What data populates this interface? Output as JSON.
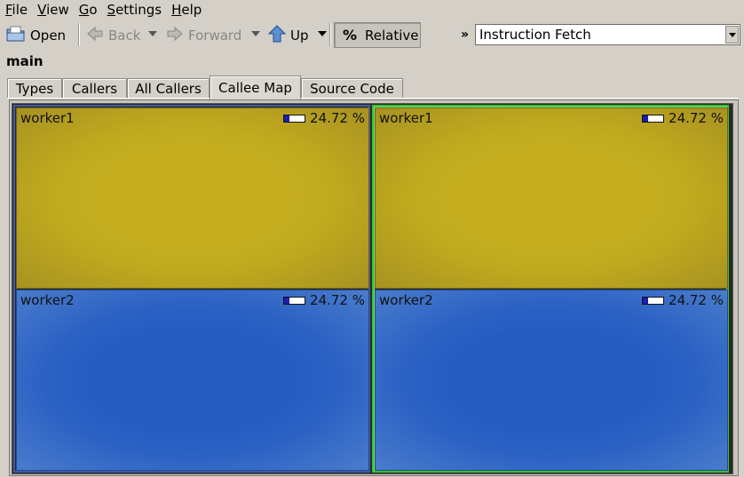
{
  "menubar": {
    "items": [
      {
        "label": "File",
        "u": "F",
        "rest": "ile"
      },
      {
        "label": "View",
        "u": "V",
        "rest": "iew"
      },
      {
        "label": "Go",
        "u": "G",
        "rest": "o"
      },
      {
        "label": "Settings",
        "u": "S",
        "rest": "ettings"
      },
      {
        "label": "Help",
        "u": "H",
        "rest": "elp"
      }
    ]
  },
  "toolbar": {
    "open_label": "Open",
    "back_label": "Back",
    "forward_label": "Forward",
    "up_label": "Up",
    "relative_symbol": "%",
    "relative_label": "Relative",
    "more_symbol": "»",
    "event_type_value": "Instruction Fetch"
  },
  "function_name": "main",
  "tabs": [
    {
      "label": "Types",
      "active": false
    },
    {
      "label": "Callers",
      "active": false
    },
    {
      "label": "All Callers",
      "active": false
    },
    {
      "label": "Callee Map",
      "active": true
    },
    {
      "label": "Source Code",
      "active": false
    }
  ],
  "callee_map": {
    "columns": [
      {
        "cells": [
          {
            "name": "worker1",
            "percent_text": "24.72 %",
            "fraction": 0.2472,
            "color": "#c4ae1f"
          },
          {
            "name": "worker2",
            "percent_text": "24.72 %",
            "fraction": 0.2472,
            "color": "#255cc2"
          }
        ]
      },
      {
        "cells": [
          {
            "name": "worker1",
            "percent_text": "24.72 %",
            "fraction": 0.2472,
            "color": "#c4ae1f"
          },
          {
            "name": "worker2",
            "percent_text": "24.72 %",
            "fraction": 0.2472,
            "color": "#255cc2"
          }
        ]
      }
    ]
  }
}
